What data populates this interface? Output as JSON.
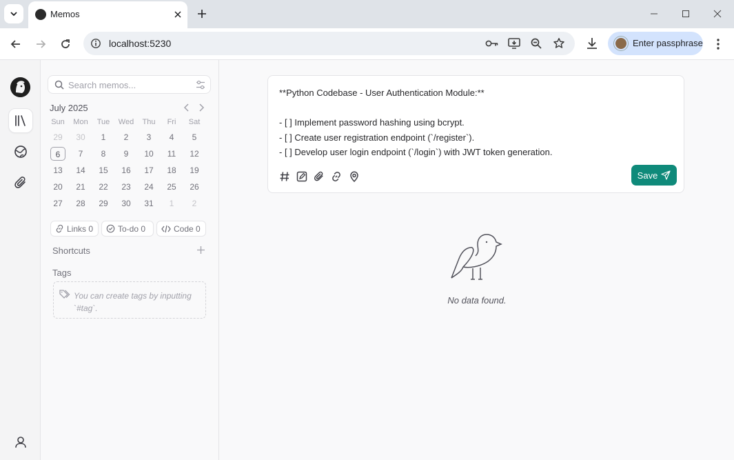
{
  "browser": {
    "tab_title": "Memos",
    "url": "localhost:5230",
    "profile_label": "Enter passphrase"
  },
  "search": {
    "placeholder": "Search memos..."
  },
  "calendar": {
    "month_label": "July 2025",
    "weekdays": [
      "Sun",
      "Mon",
      "Tue",
      "Wed",
      "Thu",
      "Fri",
      "Sat"
    ],
    "weeks": [
      [
        "29",
        "30",
        "1",
        "2",
        "3",
        "4",
        "5"
      ],
      [
        "6",
        "7",
        "8",
        "9",
        "10",
        "11",
        "12"
      ],
      [
        "13",
        "14",
        "15",
        "16",
        "17",
        "18",
        "19"
      ],
      [
        "20",
        "21",
        "22",
        "23",
        "24",
        "25",
        "26"
      ],
      [
        "27",
        "28",
        "29",
        "30",
        "31",
        "1",
        "2"
      ]
    ],
    "today": "6"
  },
  "stats": {
    "links": "Links 0",
    "todo": "To-do 0",
    "code": "Code 0"
  },
  "shortcuts": {
    "title": "Shortcuts"
  },
  "tags": {
    "title": "Tags",
    "hint": "You can create tags by inputting `#tag`."
  },
  "editor": {
    "lines": [
      "**Python Codebase - User Authentication Module:**",
      "",
      "- [ ] Implement password hashing using bcrypt.",
      "- [ ] Create user registration endpoint (`/register`).",
      "- [ ] Develop user login endpoint (`/login`) with JWT token generation."
    ],
    "save_label": "Save"
  },
  "empty_state": {
    "text": "No data found."
  },
  "colors": {
    "accent": "#0f8a7a",
    "rail_bg": "#f4f4f5",
    "border": "#e4e4e7"
  }
}
